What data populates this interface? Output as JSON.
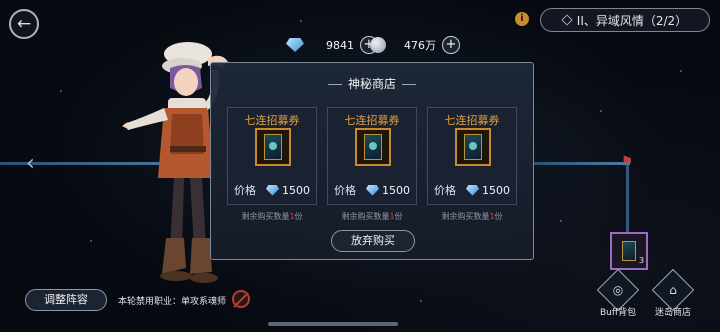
{
  "header": {
    "stage_title": "II、异域风情（2/2）",
    "info_label": "i"
  },
  "currency": {
    "diamond_value": "9841",
    "coin_value": "476万",
    "plus_label": "+"
  },
  "shop": {
    "title": "神秘商店",
    "price_label": "价格",
    "remain_prefix": "剩余购买数量",
    "remain_suffix": "份",
    "give_up_label": "放弃购买",
    "items": [
      {
        "name": "七连招募券",
        "price": "1500",
        "remain": "1"
      },
      {
        "name": "七连招募券",
        "price": "1500",
        "remain": "1"
      },
      {
        "name": "七连招募券",
        "price": "1500",
        "remain": "1"
      }
    ]
  },
  "side": {
    "item_count": "3",
    "buff_bag_label": "Buff背包",
    "island_shop_label": "迷岛商店"
  },
  "footer": {
    "adjust_label": "调整阵容",
    "ban_text": "本轮禁用职业：单攻系魂师"
  },
  "colors": {
    "accent_gold": "#e3a13c",
    "remain_red": "#d6453a",
    "path_blue": "#4d7ea6"
  },
  "icons": {
    "back": "back-arrow-icon",
    "diamond": "diamond-icon",
    "coin": "coin-icon",
    "ticket": "recruit-ticket-icon",
    "flag": "flag-icon",
    "ban": "ban-class-icon"
  }
}
